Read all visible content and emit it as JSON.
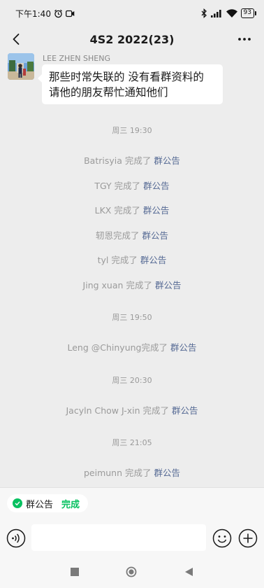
{
  "status_bar": {
    "time": "下午1:40",
    "battery": "93"
  },
  "nav": {
    "title": "4S2 2022(23)"
  },
  "message": {
    "sender": "LEE ZHEN SHENG",
    "text_line1": "那些时常失联的 没有看群资料的",
    "text_line2": "请他的朋友帮忙通知他们"
  },
  "timeline": [
    {
      "type": "time",
      "text": "周三 19:30"
    },
    {
      "type": "event",
      "name": "Batrisyia",
      "action": "完成了",
      "link": "群公告"
    },
    {
      "type": "event",
      "name": "TGY",
      "action": "完成了",
      "link": "群公告"
    },
    {
      "type": "event",
      "name": "LKX",
      "action": "完成了",
      "link": "群公告"
    },
    {
      "type": "event",
      "name": "轫恩",
      "action": "完成了",
      "link": "群公告"
    },
    {
      "type": "event",
      "name": "tyl",
      "action": "完成了",
      "link": "群公告"
    },
    {
      "type": "event",
      "name": "Jing xuan",
      "action": "完成了",
      "link": "群公告"
    },
    {
      "type": "time",
      "text": "周三 19:50"
    },
    {
      "type": "event",
      "name": "Leng @Chinyung",
      "action": "完成了",
      "link": "群公告"
    },
    {
      "type": "time",
      "text": "周三 20:30"
    },
    {
      "type": "event",
      "name": "Jacyln Chow J-xin",
      "action": "完成了",
      "link": "群公告"
    },
    {
      "type": "time",
      "text": "周三 21:05"
    },
    {
      "type": "event",
      "name": "peimunn",
      "action": "完成了",
      "link": "群公告"
    }
  ],
  "notice": {
    "label": "群公告",
    "status": "完成"
  },
  "input": {
    "value": ""
  },
  "colors": {
    "background": "#ededed",
    "link": "#576b95",
    "accent_green": "#07c160"
  }
}
